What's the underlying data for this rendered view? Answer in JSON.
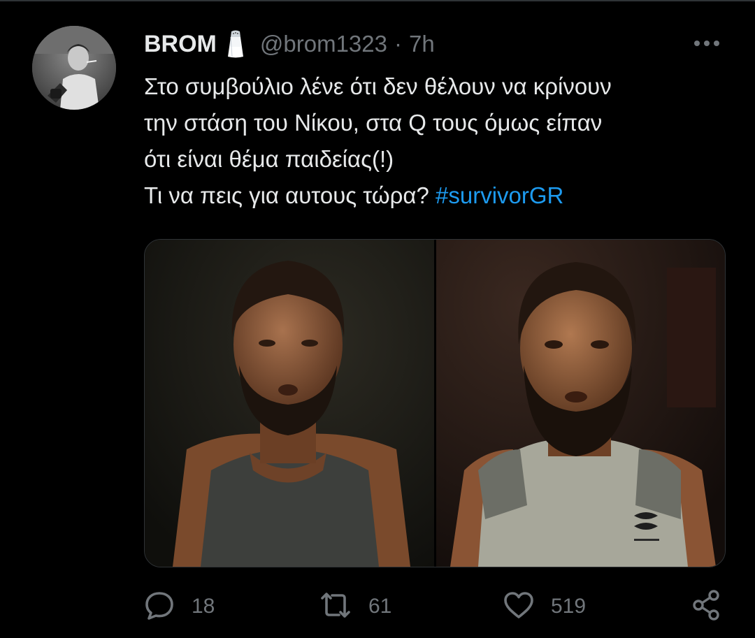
{
  "tweet": {
    "author": {
      "display_name": "BROM",
      "emoji_icon": "salt-shaker-icon",
      "handle": "@brom1323",
      "separator": "·",
      "time": "7h"
    },
    "text_lines": [
      "Στο συμβούλιο λένε ότι δεν θέλουν να κρίνουν",
      "την στάση του Νίκου, στα Q τους όμως είπαν",
      "ότι είναι θέμα παιδείας(!)",
      "Τι να πεις για αυτους τώρα? "
    ],
    "hashtag": "#survivorGR",
    "media": [
      {
        "description_icon": "photo-man-long-hair-beard"
      },
      {
        "description_icon": "photo-man-beard-tank-top"
      }
    ],
    "actions": {
      "replies": "18",
      "retweets": "61",
      "likes": "519"
    }
  },
  "colors": {
    "background": "#000000",
    "text": "#e7e9ea",
    "muted": "#71767b",
    "accent": "#1d9bf0",
    "border": "#2f3336"
  }
}
